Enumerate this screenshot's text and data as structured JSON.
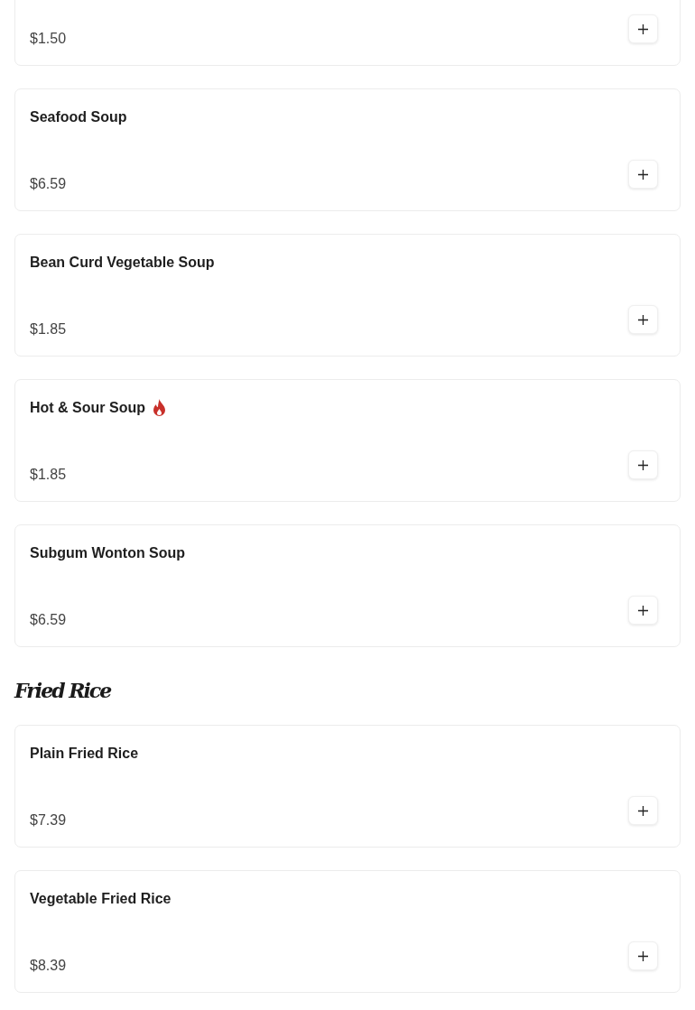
{
  "sections": [
    {
      "items": [
        {
          "price": "$1.50"
        },
        {
          "name": "Seafood Soup",
          "price": "$6.59",
          "spicy": false
        },
        {
          "name": "Bean Curd Vegetable Soup",
          "price": "$1.85",
          "spicy": false
        },
        {
          "name": "Hot & Sour Soup",
          "price": "$1.85",
          "spicy": true
        },
        {
          "name": "Subgum Wonton Soup",
          "price": "$6.59",
          "spicy": false
        }
      ]
    },
    {
      "heading": "Fried Rice",
      "items": [
        {
          "name": "Plain Fried Rice",
          "price": "$7.39",
          "spicy": false
        },
        {
          "name": "Vegetable Fried Rice",
          "price": "$8.39",
          "spicy": false
        }
      ]
    }
  ]
}
